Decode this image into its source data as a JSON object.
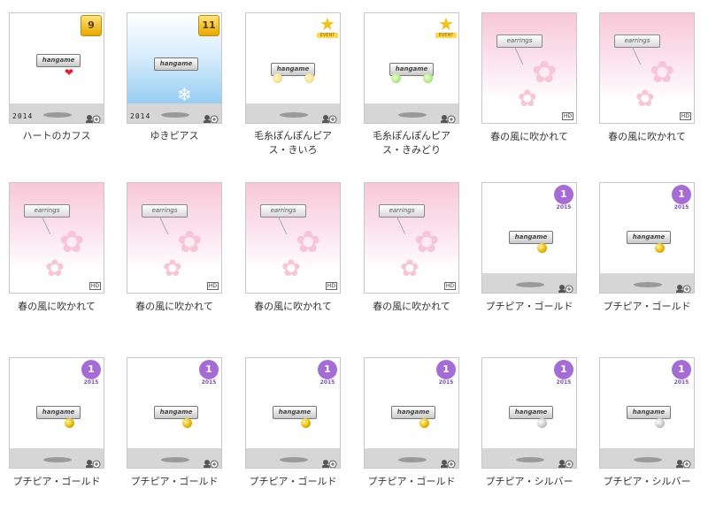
{
  "items": [
    {
      "name": "ハートのカフス",
      "kind": "brand",
      "year": "2014",
      "badge": {
        "type": "number",
        "text": "9"
      },
      "brand": "hangame",
      "accent": "heart-icon"
    },
    {
      "name": "ゆきピアス",
      "kind": "snow",
      "year": "2014",
      "badge": {
        "type": "number",
        "text": "11"
      },
      "brand": "hangame",
      "accent": "snowflake-icon"
    },
    {
      "name_line1": "毛糸ぽんぽんピア",
      "name_line2": "ス・きいろ",
      "kind": "pom",
      "pom": "yellow",
      "badge": {
        "type": "star",
        "text": "EVENT"
      },
      "brand": "hangame"
    },
    {
      "name_line1": "毛糸ぽんぽんピア",
      "name_line2": "ス・きみどり",
      "kind": "pom",
      "pom": "green",
      "badge": {
        "type": "star",
        "text": "EVENT"
      },
      "brand": "hangame"
    },
    {
      "name": "春の風に吹かれて",
      "kind": "sakura",
      "tag": "earrings",
      "hd": "HD"
    },
    {
      "name": "春の風に吹かれて",
      "kind": "sakura",
      "tag": "earrings",
      "hd": "HD"
    },
    {
      "name": "春の風に吹かれて",
      "kind": "sakura",
      "tag": "earrings",
      "hd": "HD"
    },
    {
      "name": "春の風に吹かれて",
      "kind": "sakura",
      "tag": "earrings",
      "hd": "HD"
    },
    {
      "name": "春の風に吹かれて",
      "kind": "sakura",
      "tag": "earrings",
      "hd": "HD"
    },
    {
      "name": "春の風に吹かれて",
      "kind": "sakura",
      "tag": "earrings",
      "hd": "HD"
    },
    {
      "name": "プチピア・ゴールド",
      "kind": "petit",
      "ball": "gold",
      "badge": {
        "type": "circle",
        "text": "1",
        "year": "2015"
      },
      "brand": "hangame"
    },
    {
      "name": "プチピア・ゴールド",
      "kind": "petit",
      "ball": "gold",
      "badge": {
        "type": "circle",
        "text": "1",
        "year": "2015"
      },
      "brand": "hangame"
    },
    {
      "name": "プチピア・ゴールド",
      "kind": "petit",
      "ball": "gold",
      "badge": {
        "type": "circle",
        "text": "1",
        "year": "2015"
      },
      "brand": "hangame"
    },
    {
      "name": "プチピア・ゴールド",
      "kind": "petit",
      "ball": "gold",
      "badge": {
        "type": "circle",
        "text": "1",
        "year": "2015"
      },
      "brand": "hangame"
    },
    {
      "name": "プチピア・ゴールド",
      "kind": "petit",
      "ball": "gold",
      "badge": {
        "type": "circle",
        "text": "1",
        "year": "2015"
      },
      "brand": "hangame"
    },
    {
      "name": "プチピア・ゴールド",
      "kind": "petit",
      "ball": "gold",
      "badge": {
        "type": "circle",
        "text": "1",
        "year": "2015"
      },
      "brand": "hangame"
    },
    {
      "name": "プチピア・シルバー",
      "kind": "petit",
      "ball": "silver",
      "badge": {
        "type": "circle",
        "text": "1",
        "year": "2015"
      },
      "brand": "hangame"
    },
    {
      "name": "プチピア・シルバー",
      "kind": "petit",
      "ball": "silver",
      "badge": {
        "type": "circle",
        "text": "1",
        "year": "2015"
      },
      "brand": "hangame"
    }
  ],
  "icons": {
    "preview": "avatar-zoom-icon",
    "heart": "heart-icon",
    "snow": "snowflake-icon",
    "flower": "sakura-icon"
  }
}
